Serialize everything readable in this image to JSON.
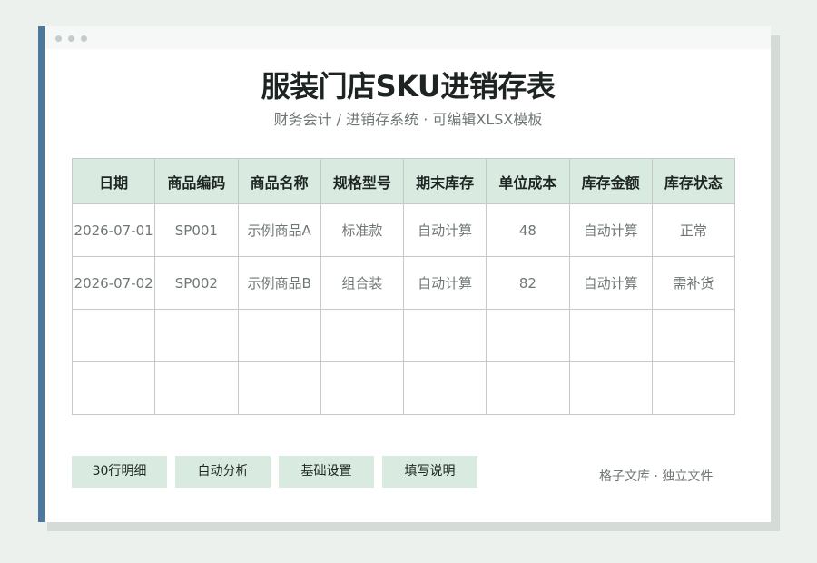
{
  "title": "服装门店SKU进销存表",
  "subtitle": "财务会计 / 进销存系统 · 可编辑XLSX模板",
  "table": {
    "headers": [
      "日期",
      "商品编码",
      "商品名称",
      "规格型号",
      "期末库存",
      "单位成本",
      "库存金额",
      "库存状态"
    ],
    "rows": [
      [
        "2026-07-01",
        "SP001",
        "示例商品A",
        "标准款",
        "自动计算",
        "48",
        "自动计算",
        "正常"
      ],
      [
        "2026-07-02",
        "SP002",
        "示例商品B",
        "组合装",
        "自动计算",
        "82",
        "自动计算",
        "需补货"
      ],
      [
        "",
        "",
        "",
        "",
        "",
        "",
        "",
        ""
      ],
      [
        "",
        "",
        "",
        "",
        "",
        "",
        "",
        ""
      ]
    ]
  },
  "buttons": [
    "30行明细",
    "自动分析",
    "基础设置",
    "填写说明"
  ],
  "footer": "格子文库 · 独立文件",
  "colors": {
    "page_background": "#edf1ee",
    "accent_bar": "#4d7899",
    "header_fill": "#d9ebe1",
    "title_text": "#1d2421",
    "muted_text": "#6f7773"
  }
}
